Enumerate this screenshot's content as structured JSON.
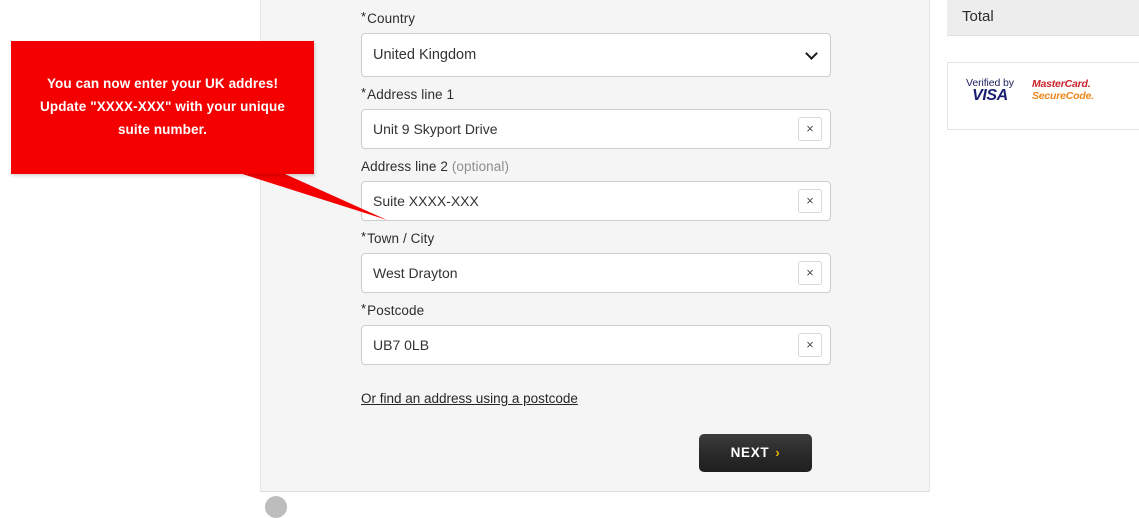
{
  "callout": {
    "text": "You can now enter your UK addres!\nUpdate \"XXXX-XXX\" with your unique\nsuite number.",
    "background_color": "#f40000",
    "text_color": "#ffffff"
  },
  "form": {
    "fields": [
      {
        "label": "Country",
        "required": true,
        "optional_note": "",
        "type": "select",
        "value": "United Kingdom",
        "placeholder": "",
        "has_clear": false,
        "chevron_icon": "chevron-down-icon"
      },
      {
        "label": "Address line 1",
        "required": true,
        "optional_note": "",
        "type": "text",
        "value": "Unit 9 Skyport Drive",
        "placeholder": "Address line 1",
        "has_clear": true,
        "clear_icon": "×"
      },
      {
        "label": "Address line 2",
        "required": false,
        "optional_note": "(optional)",
        "type": "text",
        "value": "Suite XXXX-XXX",
        "placeholder": "Address line 2",
        "has_clear": true,
        "clear_icon": "×"
      },
      {
        "label": "Town / City",
        "required": true,
        "optional_note": "",
        "type": "text",
        "value": "West Drayton",
        "placeholder": "Town / City",
        "has_clear": true,
        "clear_icon": "×"
      },
      {
        "label": "Postcode",
        "required": true,
        "optional_note": "",
        "type": "text",
        "value": "UB7 0LB",
        "placeholder": "Postcode",
        "has_clear": true,
        "clear_icon": "×"
      }
    ],
    "postcode_link": "Or find an address using a postcode",
    "next_label": "NEXT",
    "next_chevron": "›",
    "next_chevron_color": "#f2b705",
    "required_marker": "*"
  },
  "sidebar": {
    "total_title": "Total",
    "badges": {
      "visa_verified_text": "Verified by",
      "visa_word": "VISA",
      "visa_color": "#1a1f71",
      "mastercard_word": "MasterCard.",
      "mastercard_color": "#cc2229",
      "securecode_word": "SecureCode.",
      "securecode_color": "#f0861b"
    }
  }
}
